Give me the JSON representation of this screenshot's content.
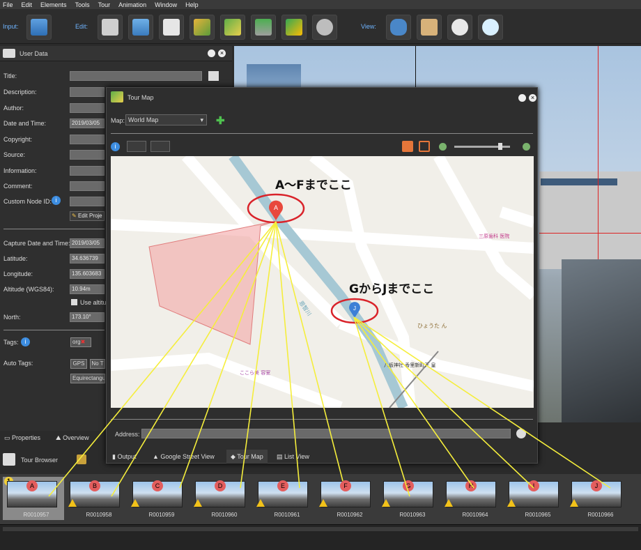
{
  "menu": [
    "File",
    "Edit",
    "Elements",
    "Tools",
    "Tour",
    "Animation",
    "Window",
    "Help"
  ],
  "toolbar": {
    "input_label": "Input:",
    "edit_label": "Edit:",
    "view_label": "View:"
  },
  "user_data": {
    "title": "User Data",
    "labels": {
      "title": "Title:",
      "description": "Description:",
      "author": "Author:",
      "datetime": "Date and Time:",
      "copyright": "Copyright:",
      "source": "Source:",
      "information": "Information:",
      "comment": "Comment:",
      "custom_node_id": "Custom Node ID:",
      "capture_datetime": "Capture Date and Time:",
      "latitude": "Latitude:",
      "longitude": "Longitude:",
      "altitude": "Altitude (WGS84):",
      "north": "North:",
      "tags": "Tags:",
      "auto_tags": "Auto Tags:"
    },
    "values": {
      "datetime": "2019/03/05",
      "capture_datetime": "2019/03/05",
      "latitude": "34.636739",
      "longitude": "135.603683",
      "altitude": "10.94m",
      "north": "173.10°"
    },
    "edit_button": "Edit Proje",
    "use_alt": "Use altitu",
    "tag": "org",
    "auto_tags": [
      "GPS",
      "No T",
      "Equirectangu"
    ]
  },
  "tour_map": {
    "title": "Tour Map",
    "map_label": "Map:",
    "map_select": "World Map",
    "address_label": "Address:",
    "tabs": [
      "Output",
      "Google Street View",
      "Tour Map",
      "List View"
    ],
    "slider_value": 0.85,
    "annotation_af": "A〜Fまでここ",
    "annotation_gj": "GからJまでここ",
    "marker_a": "A",
    "marker_j": "J",
    "poi": {
      "dental": "三原歯科\n医院",
      "restaurant": "ひょうた\nん",
      "shrine": "八坂神社\n香里新町天\n皇",
      "temple": "ここら美\n容室",
      "river": "恩智川"
    }
  },
  "bottom_tabs": {
    "properties": "Properties",
    "overview": "Overview"
  },
  "tour_browser": {
    "title": "Tour Browser",
    "group_number": "1"
  },
  "thumbnails": [
    {
      "label": "A",
      "name": "R0010957"
    },
    {
      "label": "B",
      "name": "R0010958"
    },
    {
      "label": "C",
      "name": "R0010959"
    },
    {
      "label": "D",
      "name": "R0010960"
    },
    {
      "label": "E",
      "name": "R0010961"
    },
    {
      "label": "F",
      "name": "R0010962"
    },
    {
      "label": "G",
      "name": "R0010963"
    },
    {
      "label": "H",
      "name": "R0010964"
    },
    {
      "label": "I",
      "name": "R0010965"
    },
    {
      "label": "J",
      "name": "R0010966"
    }
  ],
  "colors": {
    "accent_blue": "#6fb4ff",
    "badge_red": "#e35d5d",
    "annotation_yellow": "#f5ee3c",
    "callout_red": "#d9232a",
    "warning": "#f2c21a"
  }
}
